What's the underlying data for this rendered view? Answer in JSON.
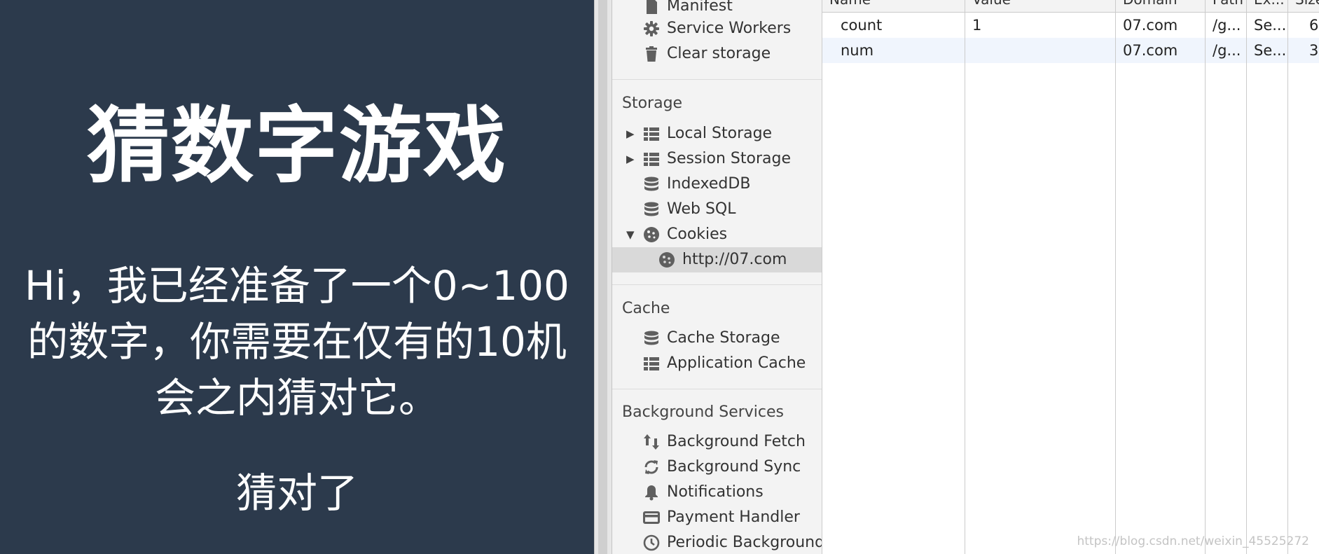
{
  "game": {
    "title": "猜数字游戏",
    "intro": "Hi，我已经准备了一个0~100的数字，你需要在仅有的10机会之内猜对它。",
    "result": "猜对了"
  },
  "sidebar": {
    "application_items": [
      {
        "label": "Manifest",
        "icon": "document-icon"
      },
      {
        "label": "Service Workers",
        "icon": "gear-icon"
      },
      {
        "label": "Clear storage",
        "icon": "trash-icon"
      }
    ],
    "storage": {
      "title": "Storage",
      "items": [
        {
          "label": "Local Storage",
          "icon": "grid-icon",
          "expander": "▶"
        },
        {
          "label": "Session Storage",
          "icon": "grid-icon",
          "expander": "▶"
        },
        {
          "label": "IndexedDB",
          "icon": "database-icon",
          "expander": ""
        },
        {
          "label": "Web SQL",
          "icon": "database-icon",
          "expander": ""
        },
        {
          "label": "Cookies",
          "icon": "cookie-icon",
          "expander": "▼"
        }
      ],
      "cookie_origin": "http://07.com"
    },
    "cache": {
      "title": "Cache",
      "items": [
        {
          "label": "Cache Storage",
          "icon": "database-icon"
        },
        {
          "label": "Application Cache",
          "icon": "grid-icon"
        }
      ]
    },
    "background_services": {
      "title": "Background Services",
      "items": [
        {
          "label": "Background Fetch",
          "icon": "up-down-arrows-icon"
        },
        {
          "label": "Background Sync",
          "icon": "sync-icon"
        },
        {
          "label": "Notifications",
          "icon": "bell-icon"
        },
        {
          "label": "Payment Handler",
          "icon": "card-icon"
        },
        {
          "label": "Periodic Background Sy",
          "icon": "clock-icon"
        }
      ]
    }
  },
  "cookie_table": {
    "columns": [
      "Name",
      "Value",
      "Domain",
      "Path",
      "Ex...",
      "Size"
    ],
    "rows": [
      {
        "name": "count",
        "value": "1",
        "domain": "07.com",
        "path": "/g...",
        "expires": "Se...",
        "size": "6"
      },
      {
        "name": "num",
        "value": "",
        "domain": "07.com",
        "path": "/g...",
        "expires": "Se...",
        "size": "3"
      }
    ]
  },
  "watermark": "https://blog.csdn.net/weixin_45525272",
  "colors": {
    "game_background": "#2c3a4c",
    "sidebar_background": "#f3f3f3",
    "selected_row": "#d9d9d9",
    "alt_row": "#f0f5fd"
  }
}
